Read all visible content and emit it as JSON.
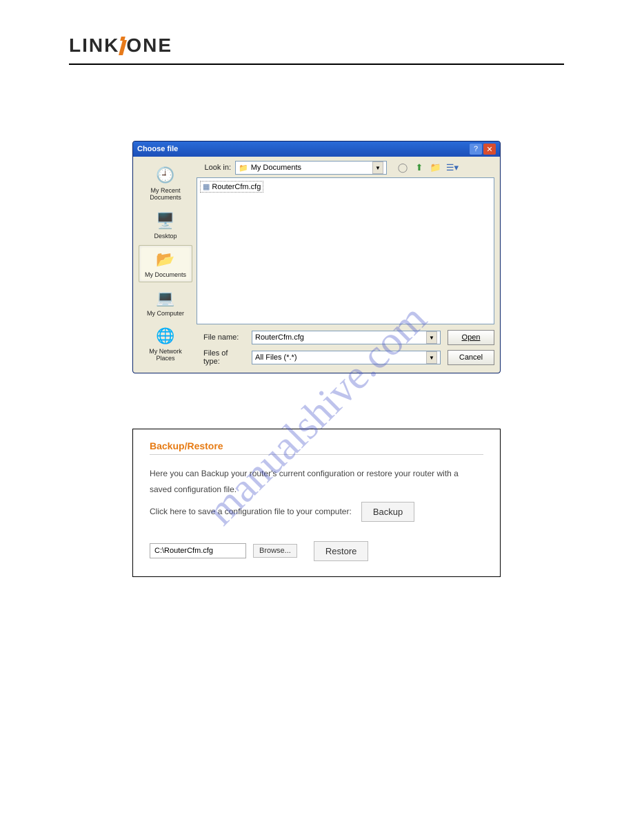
{
  "logo": {
    "part1": "LINK",
    "part2": "ONE"
  },
  "dialog": {
    "title": "Choose file",
    "lookin_label": "Look in:",
    "lookin_value": "My Documents",
    "file_selected": "RouterCfm.cfg",
    "filename_label": "File name:",
    "filename_value": "RouterCfm.cfg",
    "filetype_label": "Files of type:",
    "filetype_value": "All Files (*.*)",
    "open_btn": "Open",
    "cancel_btn": "Cancel",
    "sidebar": [
      {
        "label": "My Recent Documents"
      },
      {
        "label": "Desktop"
      },
      {
        "label": "My Documents"
      },
      {
        "label": "My Computer"
      },
      {
        "label": "My Network Places"
      }
    ]
  },
  "panel": {
    "title": "Backup/Restore",
    "line1": "Here you can Backup your router's current configuration or restore your router with a",
    "line2": "saved configuration file.",
    "click_label": "Click here to save a configuration file to your computer:",
    "backup_btn": "Backup",
    "path_value": "C:\\RouterCfm.cfg",
    "browse_btn": "Browse...",
    "restore_btn": "Restore"
  },
  "watermark": "manualshive.com"
}
